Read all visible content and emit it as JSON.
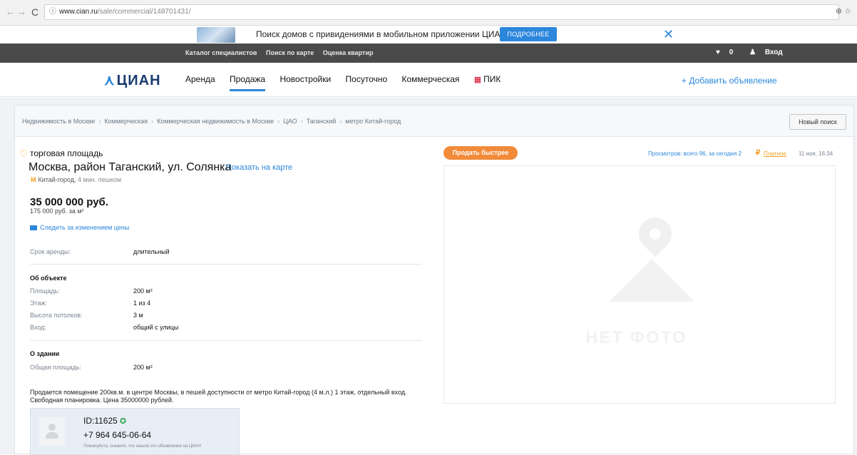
{
  "browser": {
    "url_host": "www.cian.ru",
    "url_path": "/sale/commercial/148701431/"
  },
  "promo": {
    "text": "Поиск домов с привидениями в мобильном приложении ЦИАН",
    "button": "ПОДРОБНЕЕ"
  },
  "topnav": {
    "links": [
      "Каталог специалистов",
      "Поиск по карте",
      "Оценка квартир"
    ],
    "favorites_count": "0",
    "login": "Вход"
  },
  "header": {
    "logo": "ЦИАН",
    "nav": [
      "Аренда",
      "Продажа",
      "Новостройки",
      "Посуточно",
      "Коммерческая",
      "ПИК"
    ],
    "add_ad": "+ Добавить объявление"
  },
  "breadcrumbs": [
    "Недвижимость в Москве",
    "Коммерческая",
    "Коммерческая недвижимость в Москве",
    "ЦАО",
    "Таганский",
    "метро Китай-город"
  ],
  "new_search": "Новый поиск",
  "listing": {
    "type": "торговая площадь",
    "address": "Москва, район Таганский, ул. Солянка",
    "show_map": "Показать на карте",
    "metro": "Китай-город,",
    "metro_walk": "4 мин. пешком",
    "price": "35 000 000 руб.",
    "price_m2": "175 000 руб. за м²",
    "follow": "Следить за изменением цены",
    "lease_label": "Срок аренды:",
    "lease_value": "длительный",
    "about_object": "Об объекте",
    "area_label": "Площадь:",
    "area_value": "200 м²",
    "floor_label": "Этаж:",
    "floor_value": "1 из 4",
    "ceiling_label": "Высота потолков:",
    "ceiling_value": "3 м",
    "entrance_label": "Вход:",
    "entrance_value": "общий с улицы",
    "about_building": "О здании",
    "total_area_label": "Общая площадь:",
    "total_area_value": "200 м²",
    "description": "Продается помещение 200кв.м. в центре Москвы, в пешей доступности от метро Китай-город (4 м.л.) 1 этаж, отдельный вход. Свободная планировка. Цена 35000000 рублей."
  },
  "contact": {
    "id": "ID:11625",
    "phone": "+7 964 645-06-64",
    "note": "Пожалуйста, скажите, что нашли это объявление на ЦИАН"
  },
  "right": {
    "sell_faster": "Продать быстрее",
    "views": "Просмотров: всего 96, за сегодня 2",
    "paid": "Платное",
    "date": "11 ноя, 16:34",
    "no_photo": "НЕТ ФОТО"
  }
}
